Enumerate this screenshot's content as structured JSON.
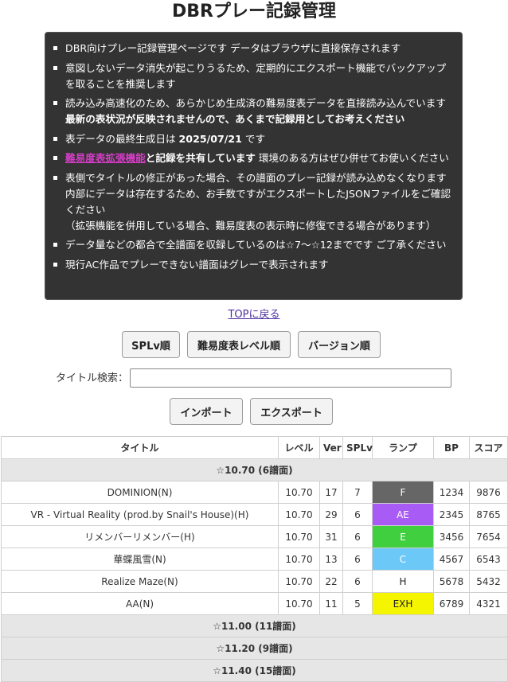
{
  "page": {
    "title": "DBRプレー記録管理"
  },
  "notice": {
    "items": [
      {
        "pre": "DBR向けプレー記録管理ページです データはブラウザに直接保存されます"
      },
      {
        "pre": "意図しないデータ消失が起こりうるため、定期的にエクスポート機能でバックアップを取ることを推奨します"
      },
      {
        "pre": "読み込み高速化のため、あらかじめ生成済の難易度表データを直接読み込んでいます",
        "bold": "最新の表状況が反映されませんので、あくまで記録用としてお考えください"
      },
      {
        "pre": "表データの最終生成日は ",
        "bold": "2025/07/21",
        "post": " です"
      },
      {
        "link": "難易度表拡張機能",
        "bold": "と記録を共有しています",
        "post": " 環境のある方はぜひ併せてお使いください"
      },
      {
        "pre": "表側でタイトルの修正があった場合、その譜面のプレー記録が読み込めなくなります\n内部にデータは存在するため、お手数ですがエクスポートしたJSONファイルをご確認ください\n（拡張機能を併用している場合、難易度表の表示時に修復できる場合があります）"
      },
      {
        "pre": "データ量などの都合で全譜面を収録しているのは☆7〜☆12までです ご了承ください"
      },
      {
        "pre": "現行AC作品でプレーできない譜面はグレーで表示されます"
      }
    ]
  },
  "nav": {
    "top_link": "TOPに戻る"
  },
  "sort": {
    "splv": "SPLv順",
    "level": "難易度表レベル順",
    "version": "バージョン順"
  },
  "search": {
    "label": "タイトル検索：",
    "value": "",
    "placeholder": ""
  },
  "io": {
    "import": "インポート",
    "export": "エクスポート"
  },
  "table": {
    "headers": [
      "タイトル",
      "レベル",
      "Ver",
      "SPLv",
      "ランプ",
      "BP",
      "スコア"
    ],
    "groups": [
      {
        "label": "☆10.70 (6譜面)",
        "rows": [
          {
            "title": "DOMINION(N)",
            "level": "10.70",
            "ver": "17",
            "splv": "7",
            "lamp": "F",
            "lamp_color": "#666666",
            "lamp_text_color": "#ffffff",
            "bp": "1234",
            "score": "9876"
          },
          {
            "title": "VR - Virtual Reality (prod.by Snail's House)(H)",
            "level": "10.70",
            "ver": "29",
            "splv": "6",
            "lamp": "AE",
            "lamp_color": "#a95cf5",
            "lamp_text_color": "#ffffff",
            "bp": "2345",
            "score": "8765"
          },
          {
            "title": "リメンバーリメンバー(H)",
            "level": "10.70",
            "ver": "31",
            "splv": "6",
            "lamp": "E",
            "lamp_color": "#3fcf3f",
            "lamp_text_color": "#ffffff",
            "bp": "3456",
            "score": "7654"
          },
          {
            "title": "華蝶風雪(N)",
            "level": "10.70",
            "ver": "13",
            "splv": "6",
            "lamp": "C",
            "lamp_color": "#6cc8f7",
            "lamp_text_color": "#ffffff",
            "bp": "4567",
            "score": "6543"
          },
          {
            "title": "Realize Maze(N)",
            "level": "10.70",
            "ver": "22",
            "splv": "6",
            "lamp": "H",
            "lamp_color": "#ffffff",
            "lamp_text_color": "#222222",
            "bp": "5678",
            "score": "5432"
          },
          {
            "title": "AA(N)",
            "level": "10.70",
            "ver": "11",
            "splv": "5",
            "lamp": "EXH",
            "lamp_color": "#f5f500",
            "lamp_text_color": "#222222",
            "bp": "6789",
            "score": "4321"
          }
        ]
      },
      {
        "label": "☆11.00 (11譜面)",
        "rows": []
      },
      {
        "label": "☆11.20 (9譜面)",
        "rows": []
      },
      {
        "label": "☆11.40 (15譜面)",
        "rows": []
      }
    ]
  }
}
